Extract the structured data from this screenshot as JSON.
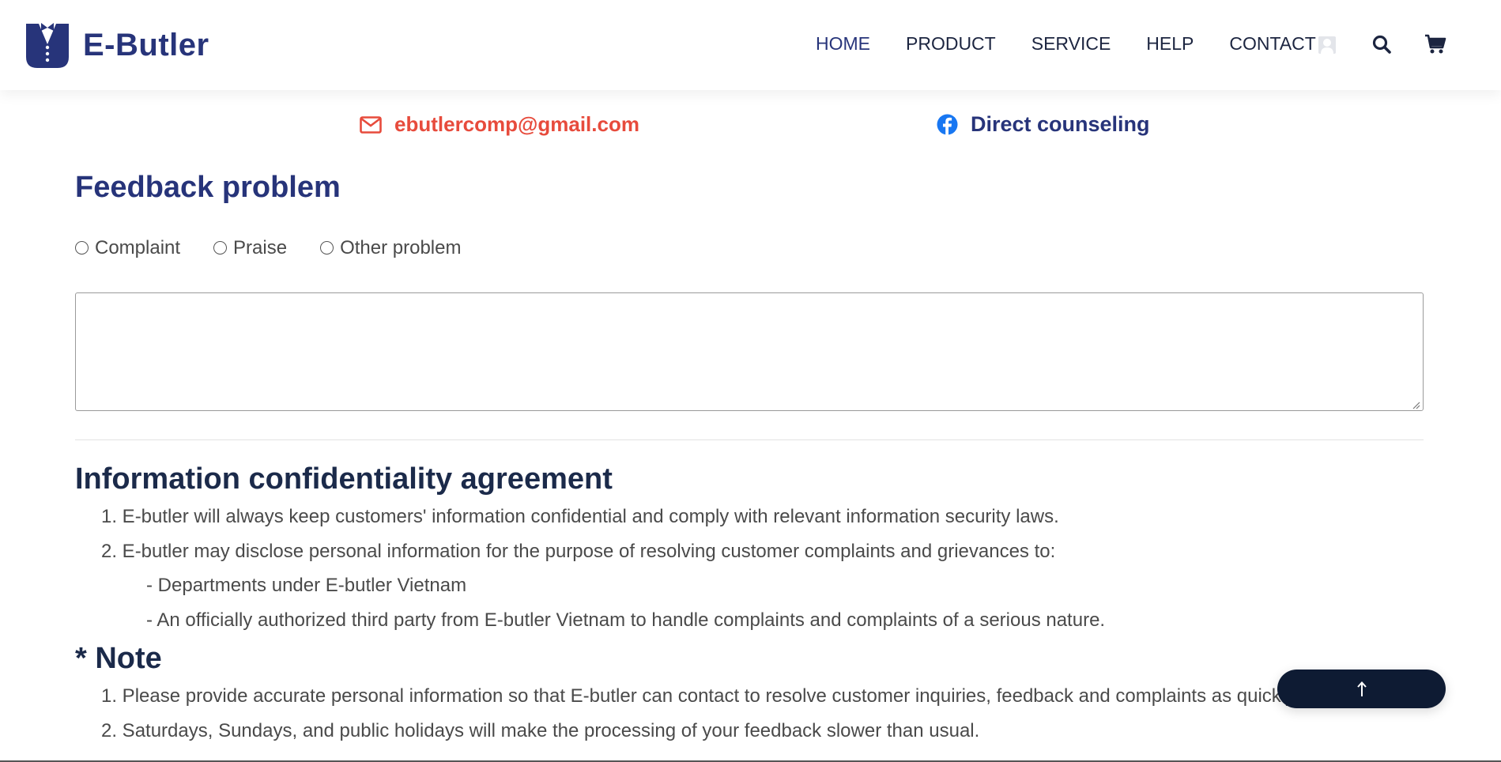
{
  "header": {
    "brand": "E-Butler",
    "nav": [
      "HOME",
      "PRODUCT",
      "SERVICE",
      "HELP",
      "CONTACT"
    ],
    "active_nav": "HOME",
    "icons": [
      "user-icon",
      "search-icon",
      "cart-icon"
    ]
  },
  "contact": {
    "email": "ebutlercomp@gmail.com",
    "facebook": "Direct counseling"
  },
  "feedback": {
    "title": "Feedback problem",
    "options": [
      "Complaint",
      "Praise",
      "Other problem"
    ],
    "textarea_value": "",
    "textarea_placeholder": ""
  },
  "agreement": {
    "title": "Information confidentiality agreement",
    "items": [
      "1. E-butler will always keep customers' information confidential and comply with relevant information security laws.",
      "2. E-butler may disclose personal information for the purpose of resolving customer complaints and grievances to:"
    ],
    "subitems": [
      "- Departments under E-butler Vietnam",
      "- An officially authorized third party from E-butler Vietnam to handle complaints and complaints of a serious nature."
    ]
  },
  "note": {
    "title": "* Note",
    "items": [
      "1. Please provide accurate personal information so that E-butler can contact to resolve customer inquiries, feedback and complaints as quickly as possible.",
      "2. Saturdays, Sundays, and public holidays will make the processing of your feedback slower than usual."
    ]
  },
  "colors": {
    "brand": "#27347a",
    "email": "#e74b3c",
    "facebook": "#1877f2",
    "back_to_top": "#0e1b33"
  }
}
